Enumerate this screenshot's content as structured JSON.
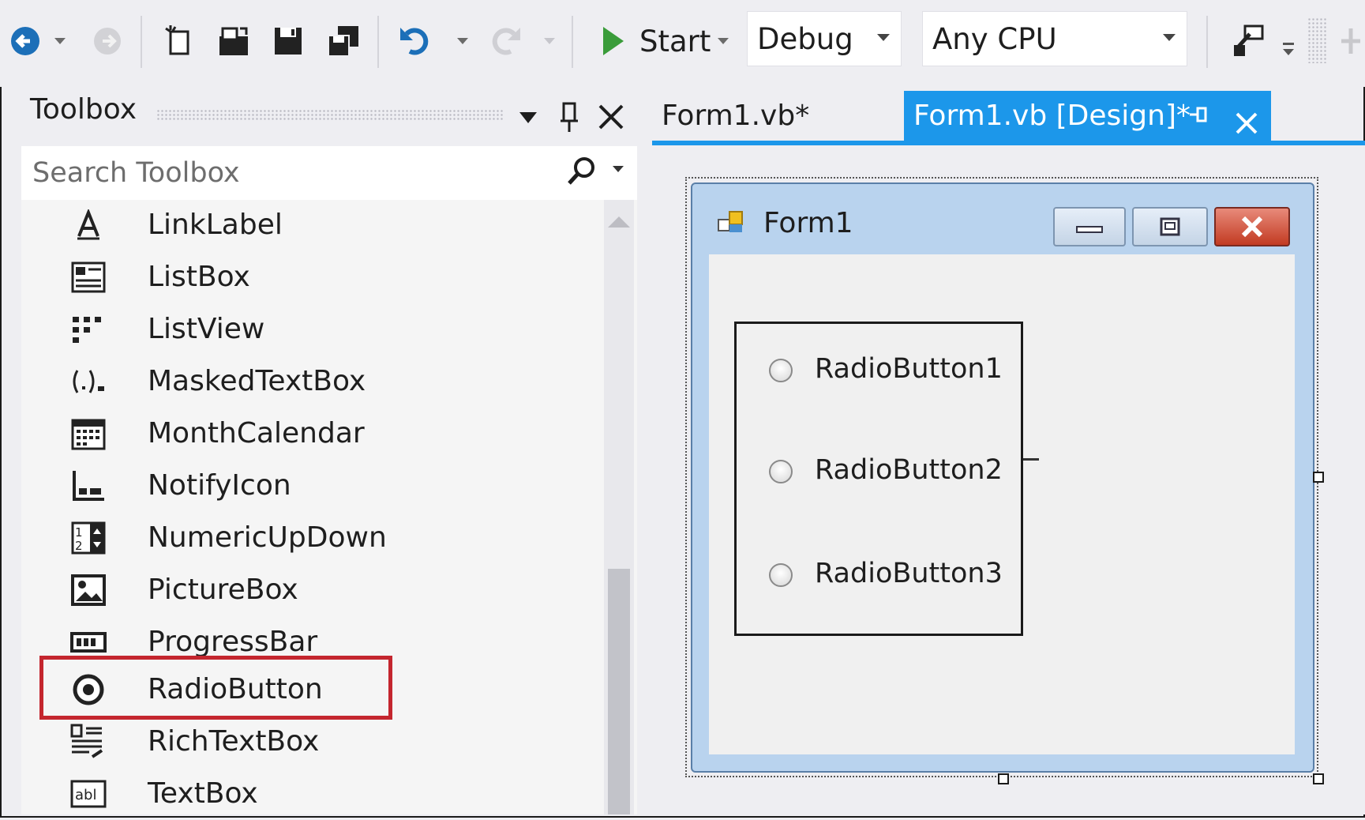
{
  "toolbar": {
    "start_label": "Start",
    "config_value": "Debug",
    "platform_value": "Any CPU",
    "icons": [
      "back-icon",
      "forward-icon",
      "new-project-icon",
      "open-file-icon",
      "save-icon",
      "save-all-icon",
      "undo-icon",
      "redo-icon",
      "start-icon",
      "attach-icon"
    ],
    "accent_start": "#3a9c3a"
  },
  "toolbox": {
    "title": "Toolbox",
    "search_placeholder": "Search Toolbox",
    "items": [
      {
        "label": "LinkLabel",
        "icon": "linklabel-icon"
      },
      {
        "label": "ListBox",
        "icon": "listbox-icon"
      },
      {
        "label": "ListView",
        "icon": "listview-icon"
      },
      {
        "label": "MaskedTextBox",
        "icon": "maskedtextbox-icon"
      },
      {
        "label": "MonthCalendar",
        "icon": "monthcalendar-icon"
      },
      {
        "label": "NotifyIcon",
        "icon": "notifyicon-icon"
      },
      {
        "label": "NumericUpDown",
        "icon": "numericupdown-icon"
      },
      {
        "label": "PictureBox",
        "icon": "picturebox-icon"
      },
      {
        "label": "ProgressBar",
        "icon": "progressbar-icon"
      },
      {
        "label": "RadioButton",
        "icon": "radiobutton-icon"
      },
      {
        "label": "RichTextBox",
        "icon": "richtextbox-icon"
      },
      {
        "label": "TextBox",
        "icon": "textbox-icon"
      }
    ],
    "highlighted_item": "RadioButton",
    "highlight_color": "#c4262e"
  },
  "tabs": [
    {
      "label": "Form1.vb*",
      "active": false
    },
    {
      "label": "Form1.vb [Design]*",
      "active": true
    }
  ],
  "tab_accent": "#1c97ea",
  "form": {
    "title": "Form1",
    "radio_buttons": [
      "RadioButton1",
      "RadioButton2",
      "RadioButton3"
    ]
  }
}
